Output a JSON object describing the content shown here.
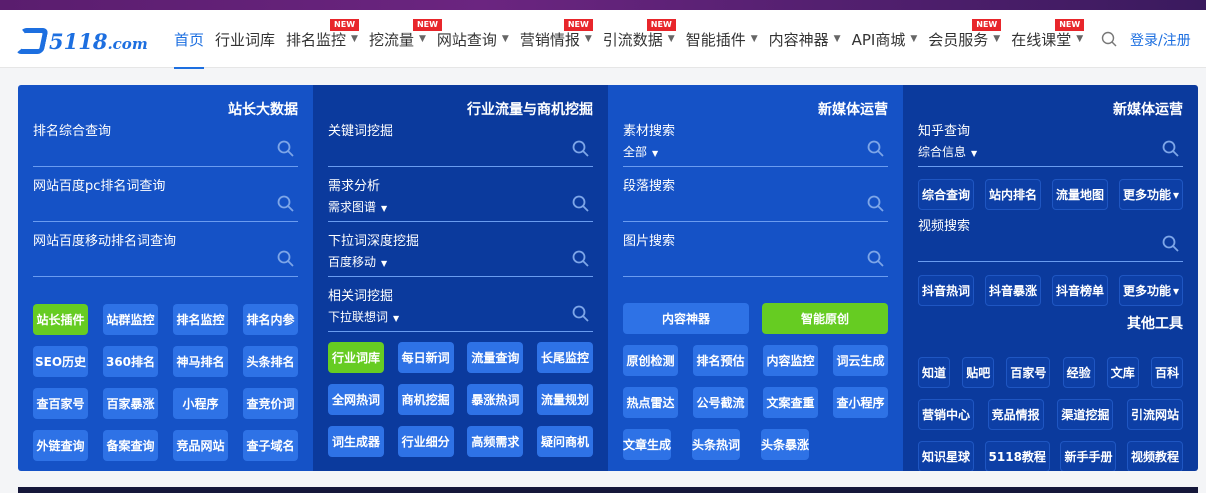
{
  "header": {
    "logo_text": "5118",
    "logo_suffix": ".com",
    "nav": [
      {
        "label": "首页",
        "active": true
      },
      {
        "label": "行业词库"
      },
      {
        "label": "排名监控",
        "dropdown": true,
        "badge": "NEW"
      },
      {
        "label": "挖流量",
        "dropdown": true,
        "badge": "NEW"
      },
      {
        "label": "网站查询",
        "dropdown": true
      },
      {
        "label": "营销情报",
        "dropdown": true,
        "badge": "NEW"
      },
      {
        "label": "引流数据",
        "dropdown": true,
        "badge": "NEW"
      },
      {
        "label": "智能插件",
        "dropdown": true
      },
      {
        "label": "内容神器",
        "dropdown": true
      },
      {
        "label": "API商城",
        "dropdown": true
      },
      {
        "label": "会员服务",
        "dropdown": true,
        "badge": "NEW"
      },
      {
        "label": "在线课堂",
        "dropdown": true,
        "badge": "NEW"
      }
    ],
    "login": "登录/注册"
  },
  "colors": {
    "accent": "#1d6fe0",
    "green": "#66cc22",
    "badge": "#e8262b"
  },
  "columns": [
    {
      "tone": "light",
      "blocks": [
        {
          "type": "title",
          "text": "站长大数据"
        },
        {
          "type": "field",
          "label": "排名综合查询"
        },
        {
          "type": "field",
          "label": "网站百度pc排名词查询"
        },
        {
          "type": "field",
          "label": "网站百度移动排名词查询"
        },
        {
          "type": "gap",
          "h": 27
        },
        {
          "type": "row",
          "buttons": [
            {
              "label": "站长插件",
              "green": true
            },
            {
              "label": "站群监控"
            },
            {
              "label": "排名监控"
            },
            {
              "label": "排名内参"
            }
          ]
        },
        {
          "type": "row",
          "buttons": [
            {
              "label": "SEO历史"
            },
            {
              "label": "360排名"
            },
            {
              "label": "神马排名"
            },
            {
              "label": "头条排名"
            }
          ]
        },
        {
          "type": "row",
          "buttons": [
            {
              "label": "查百家号"
            },
            {
              "label": "百家暴涨"
            },
            {
              "label": "小程序"
            },
            {
              "label": "查竞价词"
            }
          ]
        },
        {
          "type": "row",
          "buttons": [
            {
              "label": "外链查询"
            },
            {
              "label": "备案查询"
            },
            {
              "label": "竞品网站"
            },
            {
              "label": "查子域名"
            }
          ]
        }
      ]
    },
    {
      "tone": "dark",
      "blocks": [
        {
          "type": "title",
          "text": "行业流量与商机挖掘"
        },
        {
          "type": "field",
          "label": "关键词挖掘"
        },
        {
          "type": "field",
          "label": "需求分析",
          "sub": "需求图谱"
        },
        {
          "type": "field",
          "label": "下拉词深度挖掘",
          "sub": "百度移动"
        },
        {
          "type": "field",
          "label": "相关词挖掘",
          "sub": "下拉联想词"
        },
        {
          "type": "gap",
          "h": 10
        },
        {
          "type": "row",
          "buttons": [
            {
              "label": "行业词库",
              "green": true
            },
            {
              "label": "每日新词"
            },
            {
              "label": "流量查询"
            },
            {
              "label": "长尾监控"
            }
          ]
        },
        {
          "type": "row",
          "buttons": [
            {
              "label": "全网热词"
            },
            {
              "label": "商机挖掘"
            },
            {
              "label": "暴涨热词"
            },
            {
              "label": "流量规划"
            }
          ]
        },
        {
          "type": "row",
          "buttons": [
            {
              "label": "词生成器"
            },
            {
              "label": "行业细分"
            },
            {
              "label": "高频需求"
            },
            {
              "label": "疑问商机"
            }
          ]
        }
      ]
    },
    {
      "tone": "light",
      "blocks": [
        {
          "type": "title",
          "text": "新媒体运营"
        },
        {
          "type": "field",
          "label": "素材搜索",
          "sub": "全部"
        },
        {
          "type": "field",
          "label": "段落搜索"
        },
        {
          "type": "field",
          "label": "图片搜索"
        },
        {
          "type": "gap",
          "h": 26
        },
        {
          "type": "row",
          "wide": true,
          "buttons": [
            {
              "label": "内容神器"
            },
            {
              "label": "智能原创",
              "green": true
            }
          ]
        },
        {
          "type": "row",
          "buttons": [
            {
              "label": "原创检测"
            },
            {
              "label": "排名预估"
            },
            {
              "label": "内容监控"
            },
            {
              "label": "词云生成"
            }
          ]
        },
        {
          "type": "row",
          "buttons": [
            {
              "label": "热点雷达"
            },
            {
              "label": "公号截流"
            },
            {
              "label": "文案查重"
            },
            {
              "label": "查小程序"
            }
          ]
        },
        {
          "type": "row",
          "start": true,
          "buttons": [
            {
              "label": "文章生成"
            },
            {
              "label": "头条热词"
            },
            {
              "label": "头条暴涨"
            }
          ]
        }
      ]
    },
    {
      "tone": "dark",
      "c4": true,
      "blocks": [
        {
          "type": "title",
          "text": "新媒体运营"
        },
        {
          "type": "field",
          "label": "知乎查询",
          "sub": "综合信息"
        },
        {
          "type": "gap",
          "h": 12
        },
        {
          "type": "row",
          "buttons": [
            {
              "label": "综合查询"
            },
            {
              "label": "站内排名"
            },
            {
              "label": "流量地图"
            },
            {
              "label": "更多功能",
              "dropdown": true
            }
          ]
        },
        {
          "type": "gap",
          "h": 7
        },
        {
          "type": "field",
          "label": "视频搜索"
        },
        {
          "type": "gap",
          "h": 13
        },
        {
          "type": "row",
          "buttons": [
            {
              "label": "抖音热词"
            },
            {
              "label": "抖音暴涨"
            },
            {
              "label": "抖音榜单"
            },
            {
              "label": "更多功能",
              "dropdown": true
            }
          ]
        },
        {
          "type": "title2",
          "text": "其他工具"
        },
        {
          "type": "row",
          "buttons": [
            {
              "label": "知道"
            },
            {
              "label": "贴吧"
            },
            {
              "label": "百家号"
            },
            {
              "label": "经验"
            },
            {
              "label": "文库"
            },
            {
              "label": "百科"
            }
          ]
        },
        {
          "type": "row",
          "buttons": [
            {
              "label": "营销中心"
            },
            {
              "label": "竞品情报"
            },
            {
              "label": "渠道挖掘"
            },
            {
              "label": "引流网站"
            }
          ]
        },
        {
          "type": "row",
          "buttons": [
            {
              "label": "知识星球"
            },
            {
              "label": "5118教程"
            },
            {
              "label": "新手手册"
            },
            {
              "label": "视频教程"
            }
          ]
        }
      ]
    }
  ]
}
